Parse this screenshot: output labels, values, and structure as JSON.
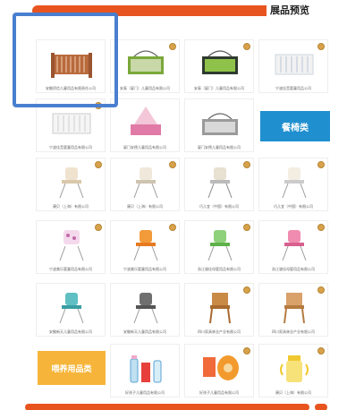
{
  "header": {
    "title": "展品预览"
  },
  "categories": {
    "dining_chairs": "餐椅类",
    "feeding_products": "喂养用品类"
  },
  "captions": [
    "安徽资信儿童用品有限责任公司",
    "安泰（厦门）儿童用品有限公司",
    "安泰（厦门）儿童用品有限公司",
    "宁波佳音婴童用品公司",
    "宁波佳音婴童用品有限公司",
    "厦门安德儿童用品有限公司",
    "厦门安德儿童用品有限公司",
    "康贝（上海）有限公司",
    "康贝（上海）有限公司",
    "巧儿宜（中国）有限公司",
    "巧儿宜（中国）有限公司",
    "宁波美乐婴童用品有限公司",
    "宁波美乐婴童用品有限公司",
    "浙江骏佳母婴用品有限公司",
    "浙江骏佳母婴用品有限公司",
    "安徽新天儿童用品有限公司",
    "安徽新天儿童用品有限公司",
    "四川家具林业产业有限公司",
    "四川家具林业产业有限公司",
    "好孩子儿童用品有限公司",
    "好孩子儿童用品有限公司",
    "康贝（上海）有限公司"
  ]
}
